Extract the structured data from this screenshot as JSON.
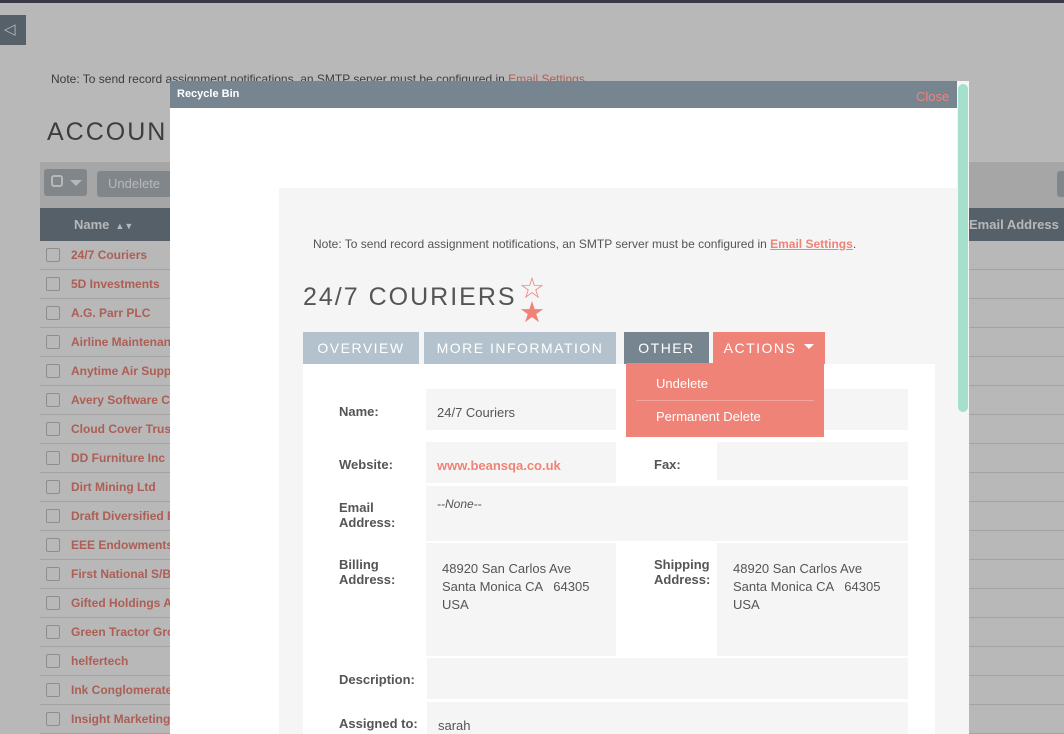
{
  "background": {
    "nav_toggle_glyph": "◁",
    "note_prefix": "Note: To send record assignment notifications, an SMTP server must be configured in ",
    "note_link": "Email Settings",
    "title": "ACCOUN",
    "undelete_label": "Undelete",
    "columns": {
      "name": "Name",
      "email": "Email Address"
    },
    "rows": [
      "24/7 Couriers",
      "5D Investments",
      "A.G. Parr PLC",
      "Airline Maintenanc",
      "Anytime Air Suppo",
      "Avery Software Co",
      "Cloud Cover Trust",
      "DD Furniture Inc",
      "Dirt Mining Ltd",
      "Draft Diversified E",
      "EEE Endowments L",
      "First National S/B",
      "Gifted Holdings AG",
      "Green Tractor Grou",
      "helfertech",
      "Ink Conglomerate",
      "Insight Marketing I"
    ]
  },
  "modal": {
    "title": "Recycle Bin",
    "close_label": "Close",
    "note_prefix": "Note: To send record assignment notifications, an SMTP server must be configured in ",
    "note_link": "Email Settings",
    "note_suffix": ".",
    "record_title": "24/7 COURIERS",
    "tabs": {
      "overview": "OVERVIEW",
      "more": "MORE INFORMATION",
      "other": "OTHER",
      "actions": "ACTIONS"
    },
    "actions_menu": [
      "Undelete",
      "Permanent Delete"
    ],
    "fields": {
      "name_label": "Name:",
      "name_value": "24/7 Couriers",
      "website_label": "Website:",
      "website_value": "www.beansqa.co.uk",
      "fax_label": "Fax:",
      "fax_value": "",
      "email_label": "Email\nAddress:",
      "email_value": "--None--",
      "billing_label": "Billing\nAddress:",
      "billing_value": "48920 San Carlos Ave\nSanta Monica CA   64305\nUSA",
      "shipping_label": "Shipping\nAddress:",
      "shipping_value": "48920 San Carlos Ave\nSanta Monica CA   64305\nUSA",
      "description_label": "Description:",
      "description_value": "",
      "assigned_label": "Assigned to:",
      "assigned_value": "sarah"
    }
  },
  "colors": {
    "accent": "#f08377",
    "header": "#778591",
    "tab_inactive": "#b3c2cc",
    "scrollbar": "#a5e0cc"
  },
  "icons": {
    "favorite_outline": "star-outline-icon",
    "favorite_filled": "star-icon"
  }
}
